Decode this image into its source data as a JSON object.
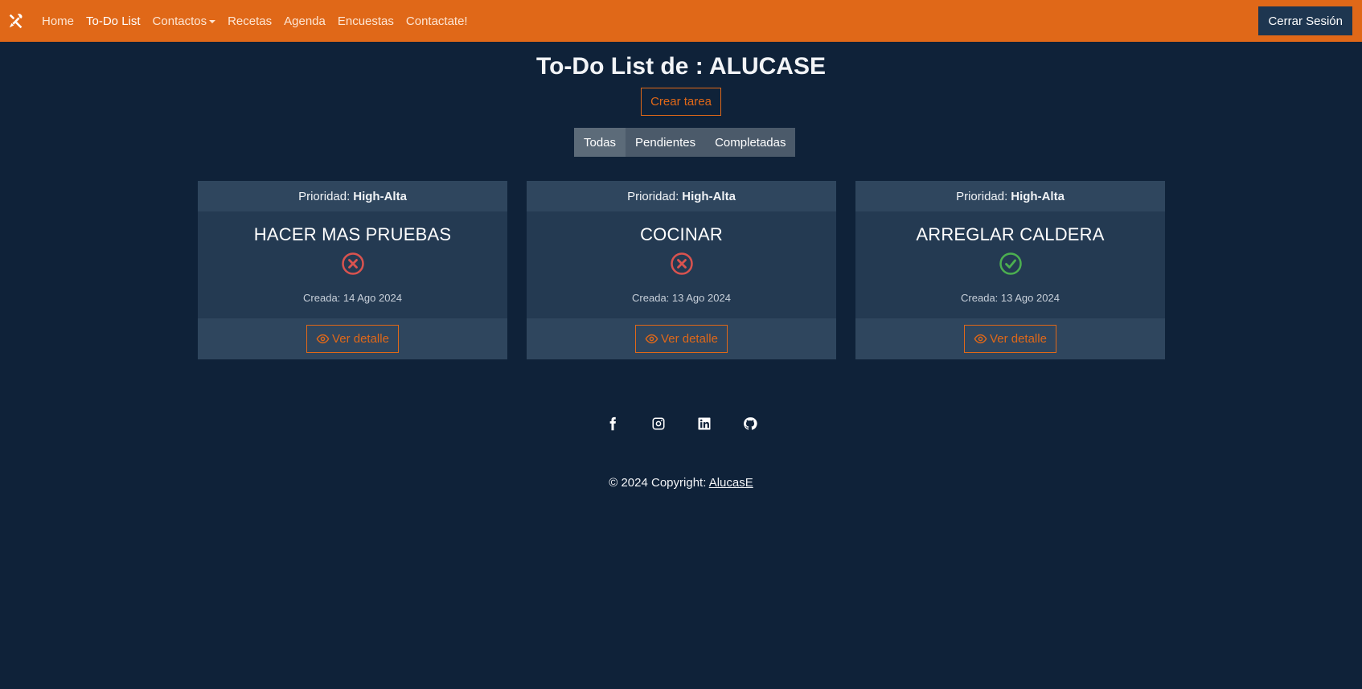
{
  "navbar": {
    "brand_icon": "tools-icon",
    "links": [
      {
        "label": "Home",
        "active": false
      },
      {
        "label": "To-Do List",
        "active": true
      },
      {
        "label": "Contactos",
        "active": false,
        "dropdown": true
      },
      {
        "label": "Recetas",
        "active": false
      },
      {
        "label": "Agenda",
        "active": false
      },
      {
        "label": "Encuestas",
        "active": false
      },
      {
        "label": "Contactate!",
        "active": false
      }
    ],
    "logout_label": "Cerrar Sesión"
  },
  "main": {
    "title": "To-Do List de : ALUCASE",
    "create_label": "Crear tarea",
    "filters": [
      {
        "label": "Todas",
        "active": true
      },
      {
        "label": "Pendientes",
        "active": false
      },
      {
        "label": "Completadas",
        "active": false
      }
    ]
  },
  "tasks": [
    {
      "priority_label": "Prioridad:",
      "priority": "High-Alta",
      "title": "HACER MAS PRUEBAS",
      "status": "pending",
      "status_icon": "x-circle-icon",
      "created": "Creada: 14 Ago 2024",
      "detail_label": "Ver detalle"
    },
    {
      "priority_label": "Prioridad:",
      "priority": "High-Alta",
      "title": "COCINAR",
      "status": "pending",
      "status_icon": "x-circle-icon",
      "created": "Creada: 13 Ago 2024",
      "detail_label": "Ver detalle"
    },
    {
      "priority_label": "Prioridad:",
      "priority": "High-Alta",
      "title": "ARREGLAR CALDERA",
      "status": "completed",
      "status_icon": "check-circle-icon",
      "created": "Creada: 13 Ago 2024",
      "detail_label": "Ver detalle"
    }
  ],
  "footer": {
    "social": [
      "facebook-icon",
      "instagram-icon",
      "linkedin-icon",
      "github-icon"
    ],
    "copyright_text": "© 2024 Copyright:",
    "copyright_link": "AlucasE"
  },
  "colors": {
    "accent": "#e06818",
    "background": "#0f2239",
    "card": "#243a52",
    "pending": "#d9534f",
    "completed": "#4caf50"
  }
}
